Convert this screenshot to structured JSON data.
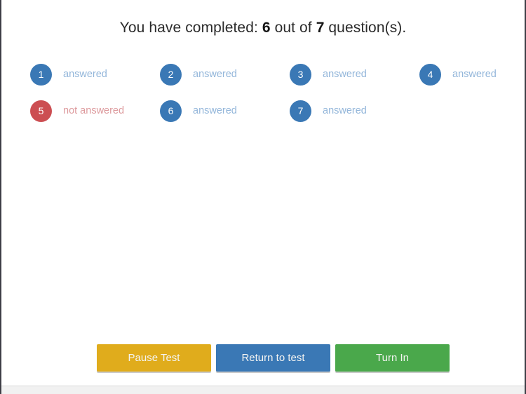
{
  "heading": {
    "prefix": "You have completed:",
    "completed": "6",
    "middle": "out of",
    "total": "7",
    "suffix": "question(s)."
  },
  "labels": {
    "answered": "answered",
    "not_answered": "not answered"
  },
  "colors": {
    "answered_bubble": "#3a78b5",
    "unanswered_bubble": "#cc4e52",
    "answered_text": "#93b6da",
    "unanswered_text": "#dd9a9d",
    "pause_button": "#e0ac1c",
    "return_button": "#3a78b5",
    "turnin_button": "#4aa84b"
  },
  "questions": [
    {
      "number": "1",
      "status": "answered",
      "label": "answered"
    },
    {
      "number": "2",
      "status": "answered",
      "label": "answered"
    },
    {
      "number": "3",
      "status": "answered",
      "label": "answered"
    },
    {
      "number": "4",
      "status": "answered",
      "label": "answered"
    },
    {
      "number": "5",
      "status": "not_answered",
      "label": "not answered"
    },
    {
      "number": "6",
      "status": "answered",
      "label": "answered"
    },
    {
      "number": "7",
      "status": "answered",
      "label": "answered"
    }
  ],
  "buttons": {
    "pause": "Pause Test",
    "return": "Return to test",
    "turn_in": "Turn In"
  }
}
